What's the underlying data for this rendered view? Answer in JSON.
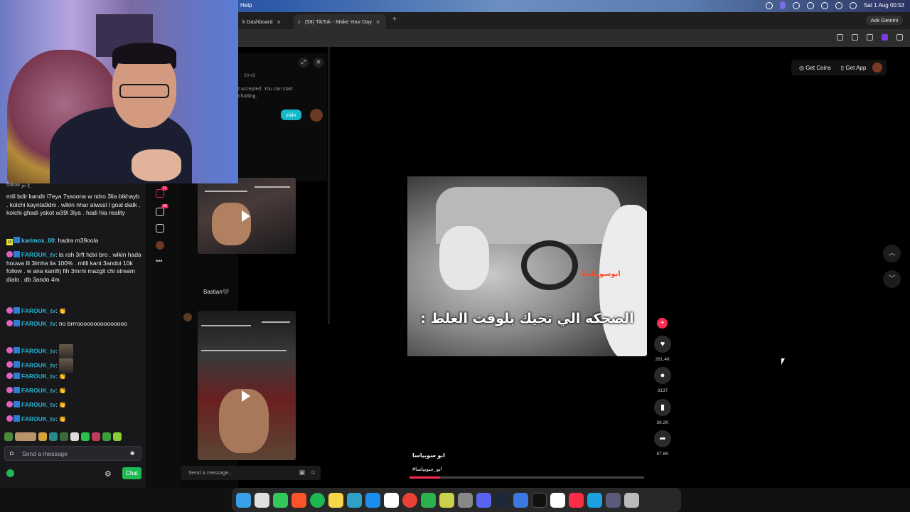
{
  "menubar": {
    "help": "Help",
    "datetime": "Sat 1 Aug  00:53"
  },
  "tabs": [
    {
      "label": "k Dashboard",
      "close": "×"
    },
    {
      "label": "(58) TikTok - Make Your Day",
      "close": "×"
    }
  ],
  "new_tab": "+",
  "gemini": "Ask Gemini",
  "chat_panel": {
    "time": "00:42",
    "system": "t accepted. You can start chatting.",
    "bubble": "ziiiin"
  },
  "embedded": {
    "badge1": "11",
    "badge2": "48",
    "bastian": "Bastian🖤",
    "send_placeholder": "Send a message..."
  },
  "twitch_chat": {
    "top_partial": "follow ع بو",
    "messages": [
      {
        "text": "mili bdir kandir l7eya 7ssoona w ndro 3lia bikhayb . kolchi kaynta9dni . wlkin nhar atwssl l goal dialk . kolchi ghadi yskot w39l 3lya . hadi hia reality"
      },
      {
        "user": "karimox_00",
        "sep": ": ",
        "text": "hadra m39oola"
      },
      {
        "user": "FAROUK_tv",
        "sep": ": ",
        "text": "la rah 3rft hdxi bro . wlkin hada houwa lli 3lmha lia 100% . milli kant 3andoi 10k follow . w ana kantfrj fih 3mrni mazglt chi stream dialo . db 3ando 4m"
      },
      {
        "user": "FAROUK_tv",
        "sep": ": ",
        "text": "👏"
      },
      {
        "user": "FAROUK_tv",
        "sep": ": ",
        "text": "no brrrooooooooooooooo"
      },
      {
        "user": "FAROUK_tv",
        "sep": ": ",
        "text": ""
      },
      {
        "user": "FAROUK_tv",
        "sep": ": ",
        "text": ""
      },
      {
        "user": "FAROUK_tv",
        "sep": ": ",
        "text": "👏"
      },
      {
        "user": "FAROUK_tv",
        "sep": ": ",
        "text": "👏"
      },
      {
        "user": "FAROUK_tv",
        "sep": ": ",
        "text": "👏"
      },
      {
        "user": "FAROUK_tv",
        "sep": ": ",
        "text": "👏"
      }
    ],
    "input_placeholder": "Send a message",
    "chat_button": "Chat"
  },
  "tiktok": {
    "get_coins": "Get Coins",
    "get_app": "Get App",
    "video_tag": "ابوسوبياسا",
    "caption": "الضحكه الي تجيك بلوقت الغلط :",
    "likes": "261.4K",
    "comments": "3137",
    "saves": "36.2K",
    "shares": "87.8K",
    "author": "ابو سوبياسا",
    "hashtag": "#ابو_سوبياسا",
    "progress": 0.13
  }
}
